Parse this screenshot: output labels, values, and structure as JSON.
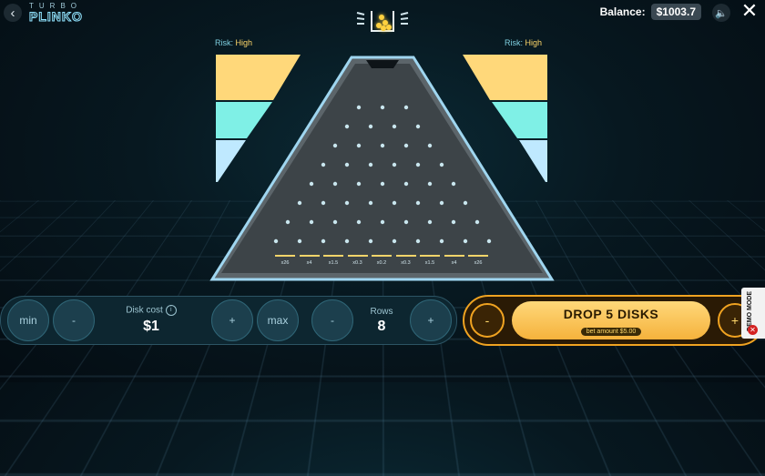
{
  "header": {
    "back_icon": "chevron-left-icon",
    "logo_top": "TURBO",
    "logo_main": "PLINKO",
    "balance_label": "Balance:",
    "balance_value": "$1003.7",
    "sound_icon": "speaker-icon",
    "close_icon": "close-icon"
  },
  "risk": {
    "left_prefix": "Risk:",
    "left_value": "High",
    "right_prefix": "Risk:",
    "right_value": "High",
    "colors": [
      "#ffd87a",
      "#7ff0e6",
      "#bfe9ff"
    ]
  },
  "board": {
    "rows": 8,
    "multipliers": [
      "x26",
      "x4",
      "x1.5",
      "x0.3",
      "x0.2",
      "x0.3",
      "x1.5",
      "x4",
      "x26"
    ]
  },
  "controls": {
    "min_label": "min",
    "minus_label": "-",
    "disk_cost_label": "Disk cost",
    "info_icon": "info-icon",
    "disk_cost_value": "$1",
    "plus_label": "+",
    "max_label": "max",
    "rows_minus_label": "-",
    "rows_label": "Rows",
    "rows_value": "8",
    "rows_plus_label": "+"
  },
  "drop": {
    "minus_label": "-",
    "title": "DROP 5 DISKS",
    "bet_amount": "bet amount $5.00",
    "plus_label": "+"
  },
  "demo": {
    "label": "DEMO MODE",
    "close_icon": "x-icon"
  }
}
